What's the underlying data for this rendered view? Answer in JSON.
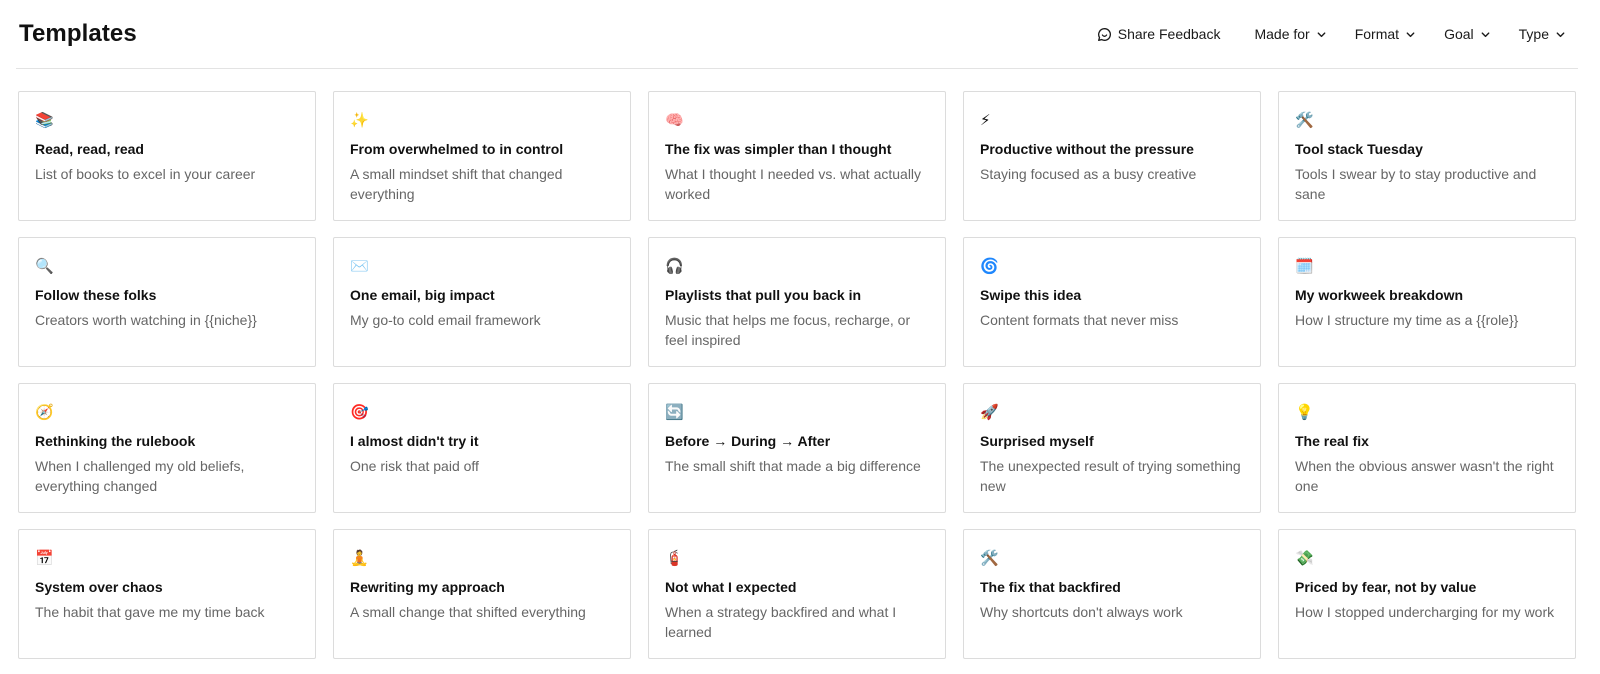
{
  "header": {
    "title": "Templates",
    "feedback_label": "Share Feedback",
    "filters": [
      {
        "label": "Made for"
      },
      {
        "label": "Format"
      },
      {
        "label": "Goal"
      },
      {
        "label": "Type"
      }
    ]
  },
  "templates": [
    {
      "emoji": "📚",
      "title": "Read, read, read",
      "desc": "List of books to excel in your career"
    },
    {
      "emoji": "✨",
      "title": "From overwhelmed to in control",
      "desc": "A small mindset shift that changed everything"
    },
    {
      "emoji": "🧠",
      "title": "The fix was simpler than I thought",
      "desc": "What I thought I needed vs. what actually worked"
    },
    {
      "emoji": "⚡",
      "title": "Productive without the pressure",
      "desc": "Staying focused as a busy creative"
    },
    {
      "emoji": "🛠️",
      "title": "Tool stack Tuesday",
      "desc": "Tools I swear by to stay productive and sane"
    },
    {
      "emoji": "🔍",
      "title": "Follow these folks",
      "desc": "Creators worth watching in {{niche}}"
    },
    {
      "emoji": "✉️",
      "title": "One email, big impact",
      "desc": "My go-to cold email framework"
    },
    {
      "emoji": "🎧",
      "title": "Playlists that pull you back in",
      "desc": "Music that helps me focus, recharge, or feel inspired"
    },
    {
      "emoji": "🌀",
      "title": "Swipe this idea",
      "desc": "Content formats that never miss"
    },
    {
      "emoji": "🗓️",
      "title": "My workweek breakdown",
      "desc": "How I structure my time as a {{role}}"
    },
    {
      "emoji": "🧭",
      "title": "Rethinking the rulebook",
      "desc": "When I challenged my old beliefs, everything changed"
    },
    {
      "emoji": "🎯",
      "title": "I almost didn't try it",
      "desc": "One risk that paid off"
    },
    {
      "emoji": "🔄",
      "title": "Before → During → After",
      "desc": "The small shift that made a big difference"
    },
    {
      "emoji": "🚀",
      "title": "Surprised myself",
      "desc": "The unexpected result of trying something new"
    },
    {
      "emoji": "💡",
      "title": "The real fix",
      "desc": "When the obvious answer wasn't the right one"
    },
    {
      "emoji": "📅",
      "title": "System over chaos",
      "desc": "The habit that gave me my time back"
    },
    {
      "emoji": "🧘",
      "title": "Rewriting my approach",
      "desc": "A small change that shifted everything"
    },
    {
      "emoji": "🧯",
      "title": "Not what I expected",
      "desc": "When a strategy backfired and what I learned"
    },
    {
      "emoji": "🛠️",
      "title": "The fix that backfired",
      "desc": "Why shortcuts don't always work"
    },
    {
      "emoji": "💸",
      "title": "Priced by fear, not by value",
      "desc": "How I stopped undercharging for my work"
    }
  ]
}
